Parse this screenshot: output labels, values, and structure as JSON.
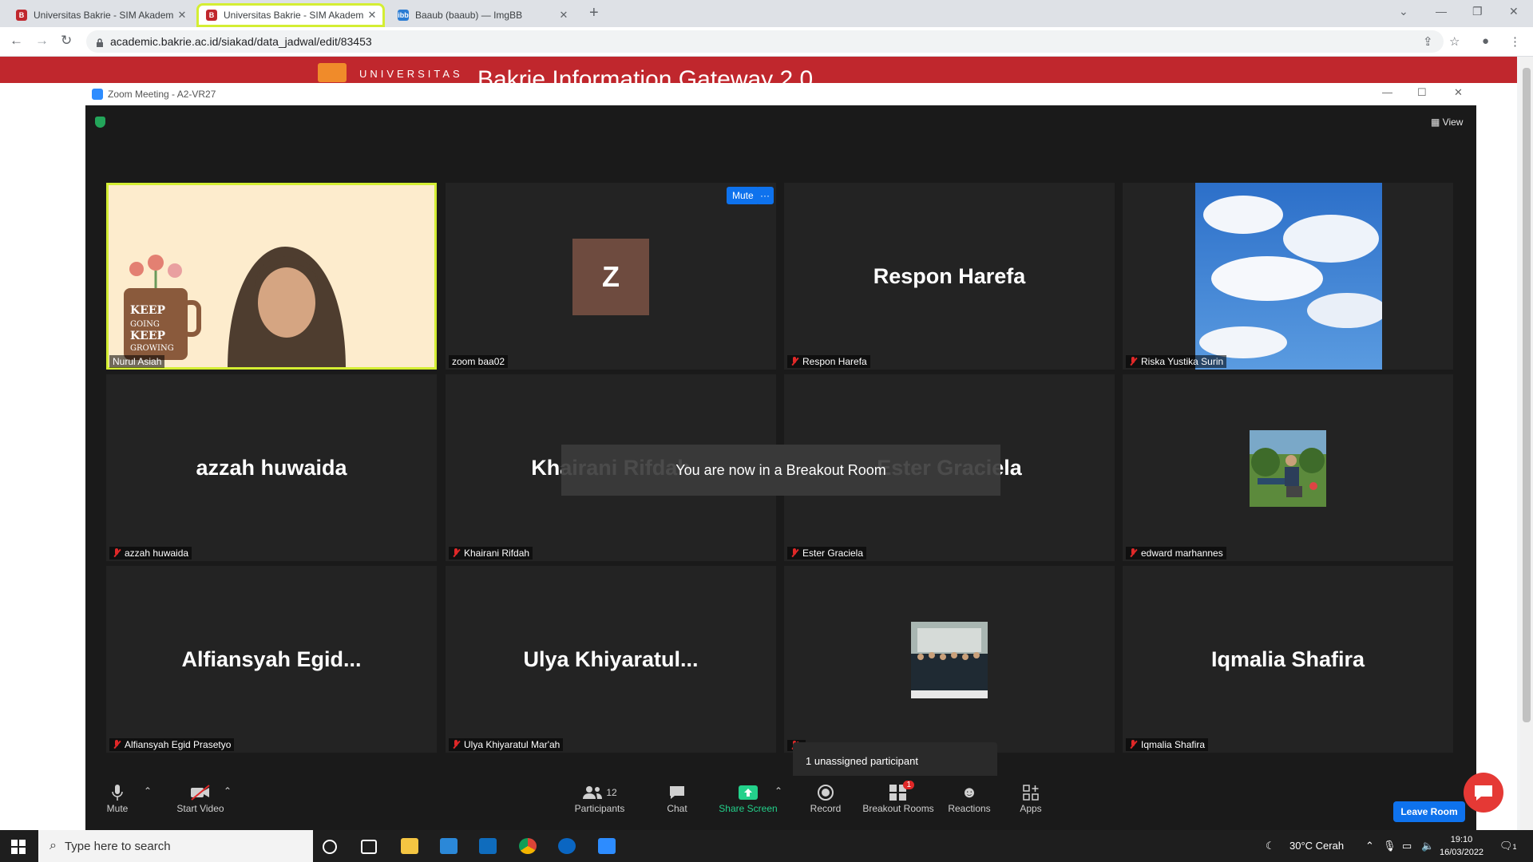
{
  "browser": {
    "tabs": [
      {
        "title": "Universitas Bakrie - SIM Akadem",
        "active": false
      },
      {
        "title": "Universitas Bakrie - SIM Akadem",
        "active": true
      },
      {
        "title": "Baaub (baaub) — ImgBB",
        "active": false
      }
    ],
    "url": "academic.bakrie.ac.id/siakad/data_jadwal/edit/83453"
  },
  "site": {
    "brand": "UNIVERSITAS",
    "gateway_title": "Bakrie Information Gateway 2.0"
  },
  "zoom": {
    "window_title": "Zoom Meeting - A2-VR27",
    "view_label": "View",
    "tile_mute_label": "Mute",
    "tile_more_label": "···",
    "notification": "You are now in a Breakout Room",
    "unassigned_popup": "1 unassigned participant",
    "participants": [
      {
        "display": "",
        "label": "Nurul Asiah",
        "muted": false,
        "kind": "video"
      },
      {
        "display": "Z",
        "label": "zoom baa02",
        "muted": false,
        "kind": "avatar"
      },
      {
        "display": "Respon Harefa",
        "label": "Respon Harefa",
        "muted": true,
        "kind": "name"
      },
      {
        "display": "",
        "label": "Riska Yustika Surin",
        "muted": true,
        "kind": "sky"
      },
      {
        "display": "azzah huwaida",
        "label": "azzah huwaida",
        "muted": true,
        "kind": "name"
      },
      {
        "display": "Khairani Rifdah",
        "label": "Khairani Rifdah",
        "muted": true,
        "kind": "name"
      },
      {
        "display": "Ester Graciela",
        "label": "Ester Graciela",
        "muted": true,
        "kind": "name"
      },
      {
        "display": "",
        "label": "edward marhannes",
        "muted": true,
        "kind": "photo"
      },
      {
        "display": "Alfiansyah  Egid...",
        "label": "Alfiansyah Egid Prasetyo",
        "muted": true,
        "kind": "name"
      },
      {
        "display": "Ulya  Khiyaratul...",
        "label": "Ulya Khiyaratul Mar'ah",
        "muted": true,
        "kind": "name"
      },
      {
        "display": "",
        "label": "",
        "muted": true,
        "kind": "group"
      },
      {
        "display": "Iqmalia Shafira",
        "label": "Iqmalia Shafira",
        "muted": true,
        "kind": "name"
      }
    ],
    "controls": {
      "mute": "Mute",
      "start_video": "Start Video",
      "participants": "Participants",
      "participants_count": "12",
      "chat": "Chat",
      "share_screen": "Share Screen",
      "record": "Record",
      "breakout_rooms": "Breakout Rooms",
      "breakout_badge": "1",
      "reactions": "Reactions",
      "apps": "Apps",
      "leave_room": "Leave Room"
    },
    "colors": {
      "active_speaker": "#d4ee33",
      "share_green": "#23d18b",
      "leave_blue": "#0e72ed"
    }
  },
  "taskbar": {
    "search_placeholder": "Type here to search",
    "weather": "30°C  Cerah",
    "time": "19:10",
    "date": "16/03/2022",
    "notif_count": "1"
  }
}
